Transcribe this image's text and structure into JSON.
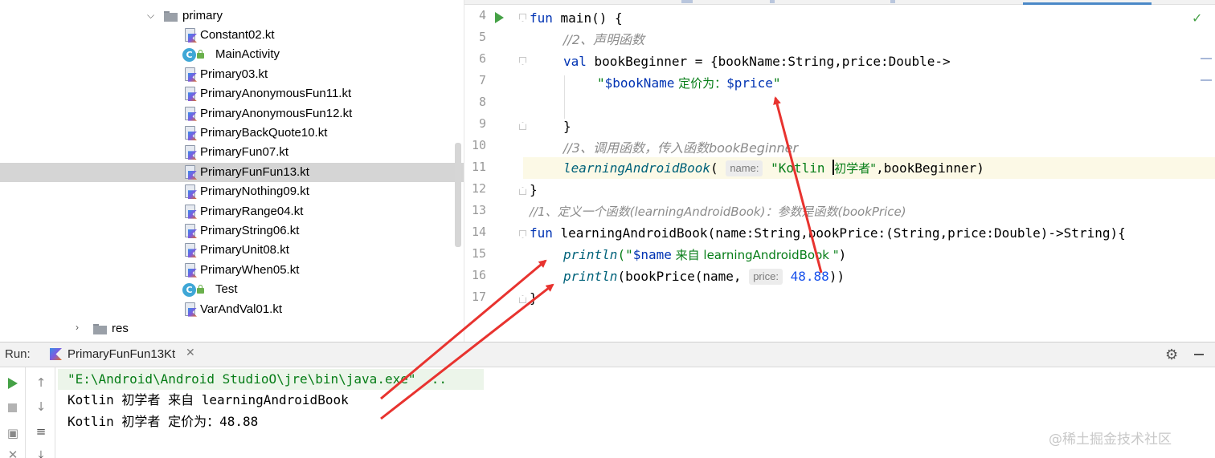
{
  "project_tree": {
    "package_name": "primary",
    "res_folder": "res",
    "files": [
      {
        "name": "Constant02.kt",
        "icon": "kotlin-file"
      },
      {
        "name": "MainActivity",
        "icon": "kotlin-class"
      },
      {
        "name": "Primary03.kt",
        "icon": "kotlin-file"
      },
      {
        "name": "PrimaryAnonymousFun11.kt",
        "icon": "kotlin-file"
      },
      {
        "name": "PrimaryAnonymousFun12.kt",
        "icon": "kotlin-file"
      },
      {
        "name": "PrimaryBackQuote10.kt",
        "icon": "kotlin-file"
      },
      {
        "name": "PrimaryFun07.kt",
        "icon": "kotlin-file"
      },
      {
        "name": "PrimaryFunFun13.kt",
        "icon": "kotlin-file",
        "selected": true
      },
      {
        "name": "PrimaryNothing09.kt",
        "icon": "kotlin-file"
      },
      {
        "name": "PrimaryRange04.kt",
        "icon": "kotlin-file"
      },
      {
        "name": "PrimaryString06.kt",
        "icon": "kotlin-file"
      },
      {
        "name": "PrimaryUnit08.kt",
        "icon": "kotlin-file"
      },
      {
        "name": "PrimaryWhen05.kt",
        "icon": "kotlin-file"
      },
      {
        "name": "Test",
        "icon": "kotlin-class"
      },
      {
        "name": "VarAndVal01.kt",
        "icon": "kotlin-file"
      }
    ]
  },
  "editor": {
    "line_numbers": [
      "4",
      "5",
      "6",
      "7",
      "8",
      "9",
      "10",
      "11",
      "12",
      "13",
      "14",
      "15",
      "16",
      "17"
    ],
    "code": {
      "l4_kw": "fun",
      "l4_rest": " main() {",
      "l5_comment": "//2、声明函数",
      "l6_kw": "val",
      "l6_rest": " bookBeginner = {bookName:String,price:Double->",
      "l7_q1": "\"",
      "l7_var1": "$bookName",
      "l7_text": " 定价为：",
      "l7_var2": "$price",
      "l7_q2": "\"",
      "l9_brace": "}",
      "l10_comment": "//3、调用函数，传入函数bookBeginner",
      "l11_fn": "learningAndroidBook",
      "l11_open": "(",
      "l11_hint": "name:",
      "l11_str_a": "\"Kotlin ",
      "l11_str_b": "初学者\"",
      "l11_rest": ",bookBeginner)",
      "l12_brace": "}",
      "l13_comment": "//1、定义一个函数(learningAndroidBook)：参数是函数(bookPrice)",
      "l14_kw": "fun",
      "l14_rest": " learningAndroidBook(name:String,bookPrice:(String,price:Double)->String){",
      "l15_fn": "println",
      "l15_open": "(\"",
      "l15_var": "$name",
      "l15_text": " 来自 learningAndroidBook \"",
      "l15_close": ")",
      "l16_fn": "println",
      "l16_rest": "(bookPrice(name, ",
      "l16_hint": "price:",
      "l16_num": "48.88",
      "l16_close": "))",
      "l17_brace": "}"
    }
  },
  "run_panel": {
    "title": "Run:",
    "tab_label": "PrimaryFunFun13Kt",
    "console": [
      "\"E:\\Android\\Android StudioO\\jre\\bin\\java.exe\" ...",
      "Kotlin 初学者 来自 learningAndroidBook",
      "Kotlin 初学者 定价为：48.88"
    ],
    "watermark": "@稀土掘金技术社区"
  },
  "colors": {
    "keyword": "#0033b3",
    "string": "#067d17",
    "comment": "#8c8c8c",
    "function": "#00627a",
    "number": "#1750eb",
    "annotation_arrow": "#e8332f",
    "selection": "#d5d5d5"
  },
  "icons": {
    "run_gutter": "run-triangle-icon",
    "settings": "gear-icon",
    "check": "check-icon"
  }
}
